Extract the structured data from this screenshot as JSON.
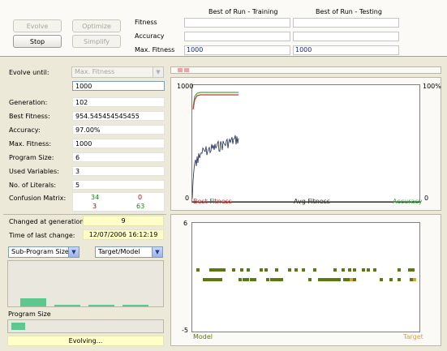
{
  "controls": {
    "evolve": "Evolve",
    "optimize": "Optimize",
    "stop": "Stop",
    "simplify": "Simplify"
  },
  "results": {
    "header_training": "Best of Run - Training",
    "header_testing": "Best of Run - Testing",
    "rows": [
      {
        "label": "Fitness",
        "training": "",
        "testing": ""
      },
      {
        "label": "Accuracy",
        "training": "",
        "testing": ""
      },
      {
        "label": "Max. Fitness",
        "training": "1000",
        "testing": "1000"
      }
    ]
  },
  "stats": {
    "evolve_until_label": "Evolve until:",
    "evolve_until_value": "Max. Fitness",
    "evolve_until_target": "1000",
    "rows": [
      {
        "label": "Generation:",
        "value": "102"
      },
      {
        "label": "Best Fitness:",
        "value": "954.545454545455"
      },
      {
        "label": "Accuracy:",
        "value": "97.00%"
      },
      {
        "label": "Max. Fitness:",
        "value": "1000"
      },
      {
        "label": "Program Size:",
        "value": "6"
      },
      {
        "label": "Used Variables:",
        "value": "3"
      },
      {
        "label": "No. of Literals:",
        "value": "5"
      }
    ],
    "confusion_label": "Confusion Matrix:",
    "confusion": {
      "tp": "34",
      "fp": "0",
      "fn": "3",
      "tn": "63"
    },
    "changed_label": "Changed at generation:",
    "changed_value": "9",
    "last_change_label": "Time of last change:",
    "last_change_value": "12/07/2006 16:12:19"
  },
  "subprogram": {
    "select_value": "Sub-Program Sizes",
    "target_select_value": "Target/Model",
    "bar_levels": [
      0.32,
      0.08,
      0.08,
      0.08
    ],
    "program_size_label": "Program Size",
    "program_size_fill": 0.09,
    "status": "Evolving..."
  },
  "fitness_chart": {
    "ymax_left": "1000",
    "ymin_left": "0",
    "ymax_right": "100%",
    "ymin_right": "0",
    "legend_best": "Best Fitness",
    "legend_avg": "Avg Fitness",
    "legend_acc": "Accuracy",
    "colors": {
      "best": "#d03030",
      "avg": "#1c2850",
      "acc": "#3cb040"
    }
  },
  "model_chart": {
    "ymax": "6",
    "ymin": "-5",
    "legend_model": "Model",
    "legend_target": "Target",
    "colors": {
      "model": "#5a7a10",
      "target": "#e0a040"
    }
  }
}
